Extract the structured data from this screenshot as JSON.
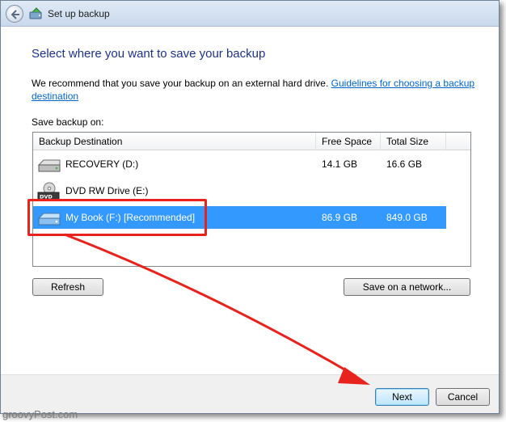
{
  "window": {
    "title": "Set up backup"
  },
  "heading": "Select where you want to save your backup",
  "intro": {
    "text": "We recommend that you save your backup on an external hard drive.",
    "link": "Guidelines for choosing a backup destination"
  },
  "save_label": "Save backup on:",
  "table": {
    "columns": [
      "Backup Destination",
      "Free Space",
      "Total Size"
    ],
    "rows": [
      {
        "name": "RECOVERY (D:)",
        "free": "14.1 GB",
        "total": "16.6 GB",
        "icon": "hard-drive-icon"
      },
      {
        "name": "DVD RW Drive (E:)",
        "free": "",
        "total": "",
        "icon": "dvd-drive-icon"
      },
      {
        "name": "My Book (F:) [Recommended]",
        "free": "86.9 GB",
        "total": "849.0 GB",
        "icon": "external-drive-icon",
        "selected": true
      }
    ]
  },
  "buttons": {
    "refresh": "Refresh",
    "save_network": "Save on a network...",
    "next": "Next",
    "cancel": "Cancel"
  },
  "colors": {
    "heading": "#1e3287",
    "link": "#0066cc",
    "selection": "#3399ff",
    "annotation": "#e8221c"
  },
  "watermark": "groovyPost.com"
}
